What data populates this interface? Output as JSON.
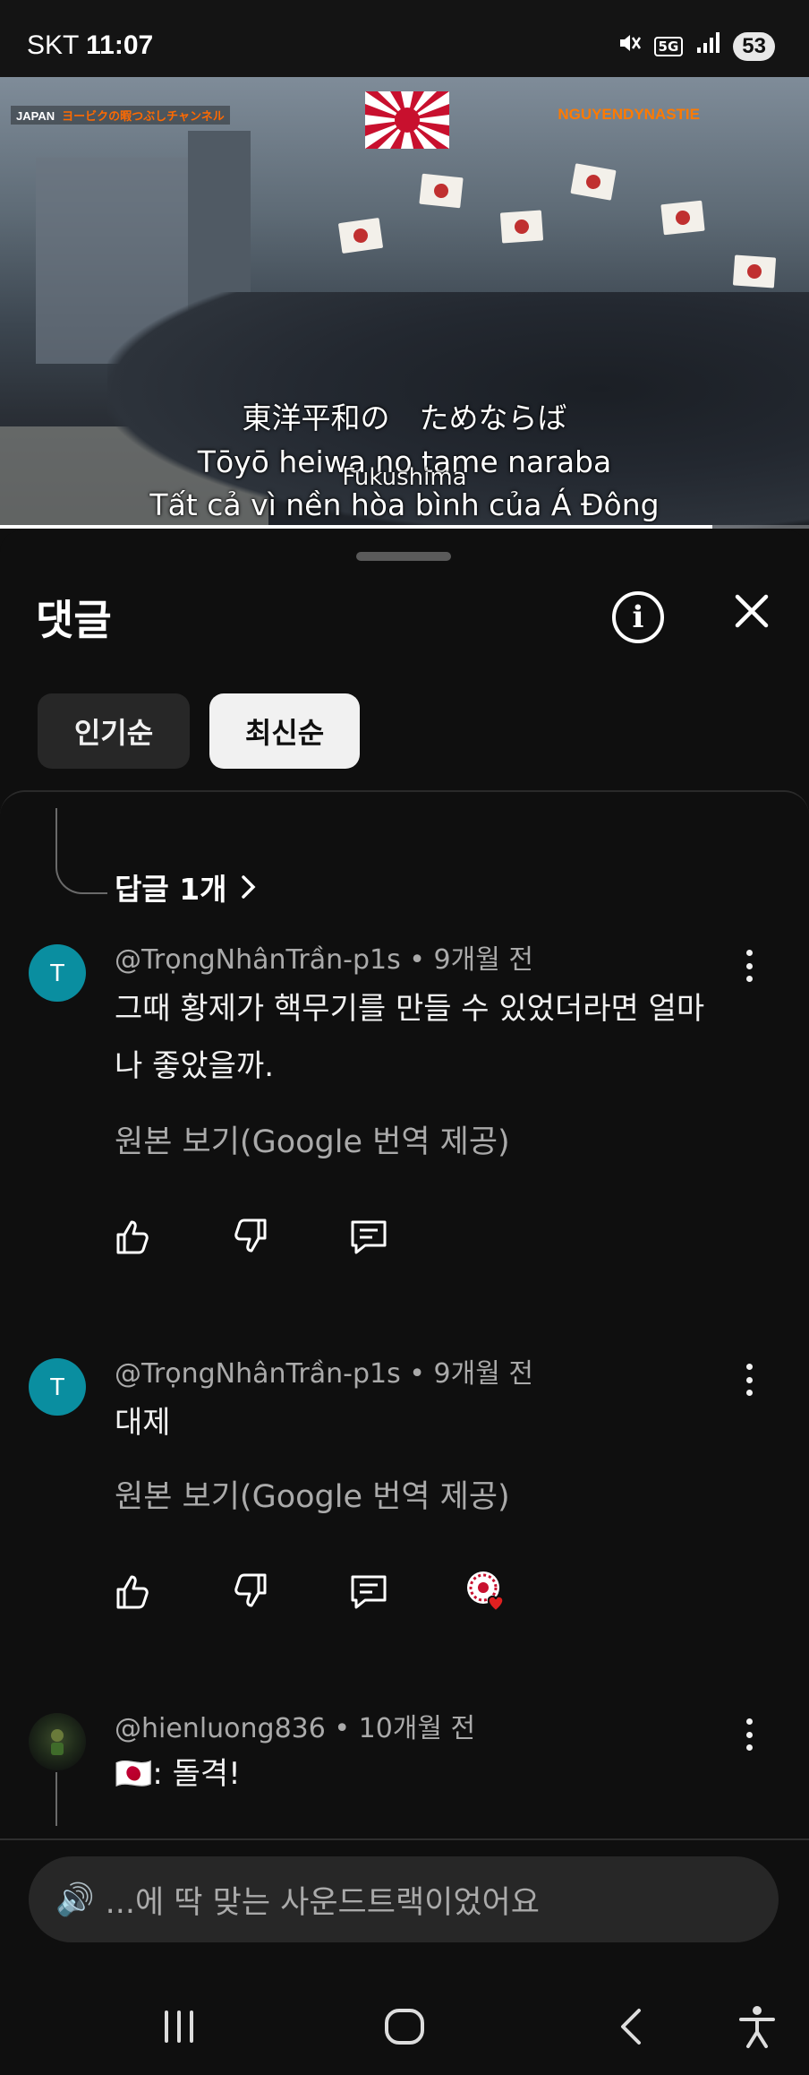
{
  "status_bar": {
    "carrier": "SKT",
    "time": "11:07",
    "network": "5G",
    "battery": "53"
  },
  "video": {
    "channel_tag_left_prefix": "JAPAN",
    "channel_tag_left": "ヨービクの暇つぶしチャンネル",
    "channel_tag_right": "NGUYENDYNASTIE",
    "subtitle_japanese": "東洋平和の　ためならば",
    "subtitle_romaji": "Tōyō heiwa no tame naraba",
    "place_label": "Fukushima",
    "subtitle_vietnamese": "Tất cả vì nền hòa bình của Á Đông",
    "progress": 0.88
  },
  "sheet": {
    "title": "댓글",
    "sort_popular": "인기순",
    "sort_newest": "최신순",
    "replies_link": "답글 1개"
  },
  "comments": [
    {
      "avatar_letter": "T",
      "author": "@TrọngNhânTrần-p1s",
      "time": "9개월 전",
      "text": "그때 황제가 핵무기를 만들 수 있었더라면 얼마나 좋았을까.",
      "translate_label": "원본 보기(Google 번역 제공)"
    },
    {
      "avatar_letter": "T",
      "author": "@TrọngNhânTrần-p1s",
      "time": "9개월 전",
      "text": "대제",
      "translate_label": "원본 보기(Google 번역 제공)"
    },
    {
      "author": "@hienluong836",
      "time": "10개월 전",
      "text": "🇯🇵: 돌격!"
    }
  ],
  "reply_input": {
    "emoji": "🔊",
    "placeholder": "...에 딱 맞는 사운드트랙이었어요"
  },
  "colors": {
    "background": "#0f0f0f",
    "avatar_teal": "#0a8ea0",
    "chip_active": "#f1f1f1",
    "chip_inactive": "#272727",
    "heart_red": "#e02020"
  }
}
